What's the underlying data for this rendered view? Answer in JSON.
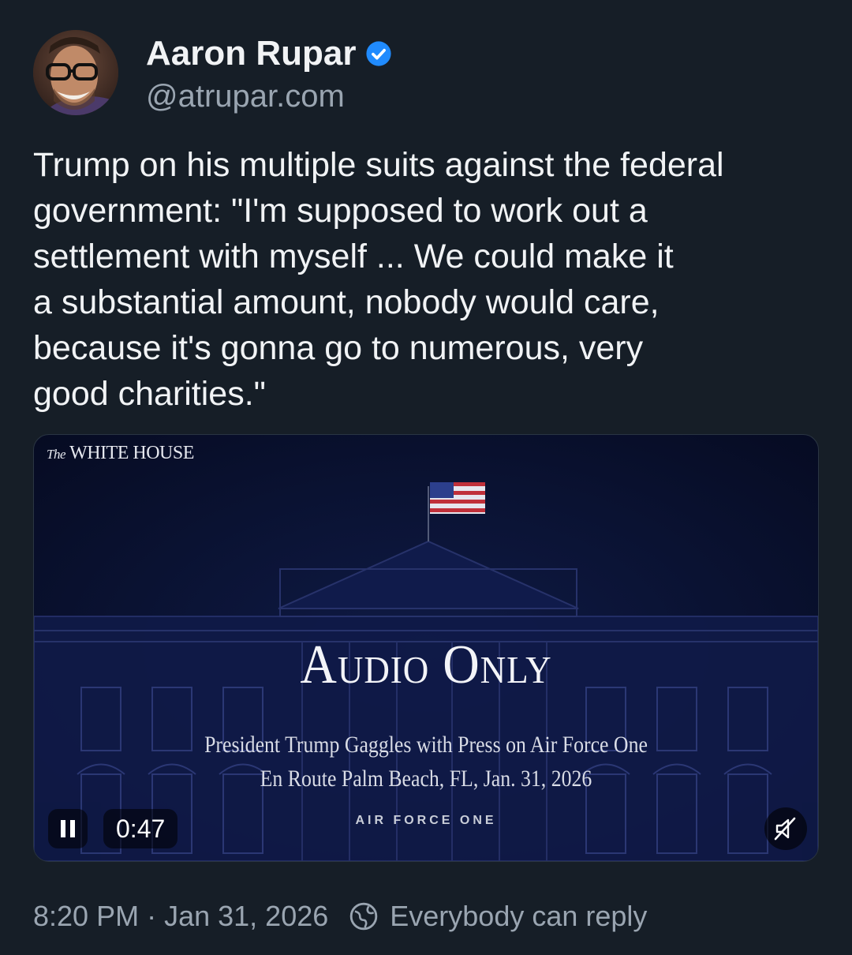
{
  "author": {
    "name": "Aaron Rupar",
    "handle": "@atrupar.com",
    "verified": true
  },
  "post": {
    "text": "Trump on his multiple suits against the federal\ngovernment: \"I'm supposed to work out a\nsettlement with myself ... We could make it\na substantial amount, nobody would care,\nbecause it's gonna go to numerous, very\ngood charities.\""
  },
  "video": {
    "brand_prefix": "The",
    "brand": "WHITE HOUSE",
    "headline": "Audio Only",
    "subtitle_line1": "President Trump Gaggles with Press on Air Force One",
    "subtitle_line2": "En Route Palm Beach, FL, Jan. 31, 2026",
    "location_tag": "AIR FORCE ONE",
    "elapsed_time": "0:47",
    "state": "playing",
    "muted": true
  },
  "meta": {
    "time": "8:20 PM",
    "separator": "·",
    "date": "Jan 31, 2026",
    "reply_setting": "Everybody can reply"
  },
  "colors": {
    "background": "#161e27",
    "text": "#f1f3f5",
    "muted_text": "#9aa5b1",
    "verified_badge": "#208bfe",
    "video_bg": "#0a1232"
  },
  "icons": [
    "verified-badge-icon",
    "pause-icon",
    "muted-speaker-icon",
    "globe-icon"
  ]
}
